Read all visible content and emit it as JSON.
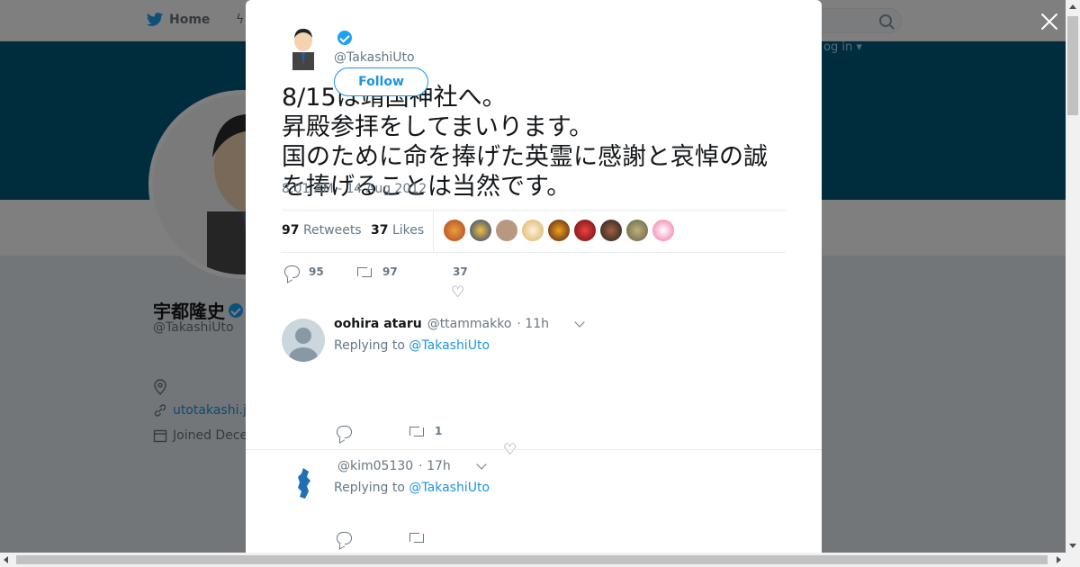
{
  "nav": {
    "home_label": "Home",
    "login_label": "og in ▾"
  },
  "colors": {
    "banner": "#005a7a",
    "accent": "#1b95e0",
    "verified": "#1da1f2"
  },
  "profile": {
    "name": "宇都隆史",
    "handle": "@TakashiUto",
    "website": "utotakashi.j",
    "joined": "Joined Dece"
  },
  "tweet": {
    "handle": "@TakashiUto",
    "follow_label": "Follow",
    "text": "8/15は靖国神社へ。\n昇殿参拝をしてまいります。\n国のために命を捧げた英霊に感謝と哀悼の誠を捧げることは当然です。",
    "time": "8:01 AM - 14 Aug 2012",
    "retweets_count": "97",
    "retweets_label": "Retweets",
    "likes_count": "37",
    "likes_label": "Likes",
    "actions": {
      "replies": "95",
      "retweets": "97",
      "likes": "37"
    }
  },
  "replies": [
    {
      "name": "oohira ataru",
      "handle": "@ttammakko",
      "time": "· 11h",
      "replying_prefix": "Replying to",
      "replying_to": "@TakashiUto",
      "retweets": "1"
    },
    {
      "name": "",
      "handle": "@kim05130",
      "time": "· 17h",
      "replying_prefix": "Replying to",
      "replying_to": "@TakashiUto"
    }
  ],
  "icons": [
    "twitter-bird-icon",
    "search-icon",
    "close-icon",
    "verified-icon",
    "location-icon",
    "link-icon",
    "calendar-icon",
    "reply-icon",
    "retweet-icon",
    "heart-icon",
    "chevron-down-icon"
  ]
}
